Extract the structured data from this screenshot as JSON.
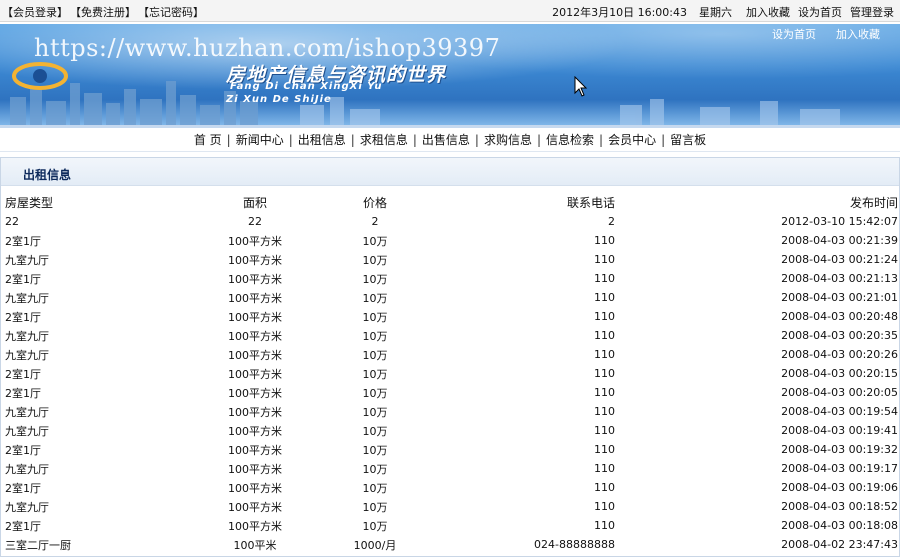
{
  "topbar": {
    "links": [
      "【会员登录】",
      "【免费注册】",
      "【忘记密码】"
    ],
    "datetime": "2012年3月10日 16:00:43",
    "weekday": "星期六",
    "right_links": [
      "加入收藏",
      "设为首页",
      "管理登录"
    ]
  },
  "banner": {
    "watermark": "https://www.huzhan.com/ishop39397",
    "slogan": "房地产信息与咨讯的世界",
    "pinyin1": "Fang Di Chan XingXi Yu",
    "pinyin2": "Zi Xun De ShiJie",
    "toplinks": [
      "设为首页",
      "加入收藏"
    ]
  },
  "nav": [
    "首 页",
    "新闻中心",
    "出租信息",
    "求租信息",
    "出售信息",
    "求购信息",
    "信息检索",
    "会员中心",
    "留言板"
  ],
  "panel": {
    "title": "出租信息",
    "headers": [
      "房屋类型",
      "面积",
      "价格",
      "联系电话",
      "发布时间"
    ],
    "rows": [
      [
        "22",
        "22",
        "2",
        "2",
        "2012-03-10 15:42:07"
      ],
      [
        "2室1厅",
        "100平方米",
        "10万",
        "110",
        "2008-04-03 00:21:39"
      ],
      [
        "九室九厅",
        "100平方米",
        "10万",
        "110",
        "2008-04-03 00:21:24"
      ],
      [
        "2室1厅",
        "100平方米",
        "10万",
        "110",
        "2008-04-03 00:21:13"
      ],
      [
        "九室九厅",
        "100平方米",
        "10万",
        "110",
        "2008-04-03 00:21:01"
      ],
      [
        "2室1厅",
        "100平方米",
        "10万",
        "110",
        "2008-04-03 00:20:48"
      ],
      [
        "九室九厅",
        "100平方米",
        "10万",
        "110",
        "2008-04-03 00:20:35"
      ],
      [
        "九室九厅",
        "100平方米",
        "10万",
        "110",
        "2008-04-03 00:20:26"
      ],
      [
        "2室1厅",
        "100平方米",
        "10万",
        "110",
        "2008-04-03 00:20:15"
      ],
      [
        "2室1厅",
        "100平方米",
        "10万",
        "110",
        "2008-04-03 00:20:05"
      ],
      [
        "九室九厅",
        "100平方米",
        "10万",
        "110",
        "2008-04-03 00:19:54"
      ],
      [
        "九室九厅",
        "100平方米",
        "10万",
        "110",
        "2008-04-03 00:19:41"
      ],
      [
        "2室1厅",
        "100平方米",
        "10万",
        "110",
        "2008-04-03 00:19:32"
      ],
      [
        "九室九厅",
        "100平方米",
        "10万",
        "110",
        "2008-04-03 00:19:17"
      ],
      [
        "2室1厅",
        "100平方米",
        "10万",
        "110",
        "2008-04-03 00:19:06"
      ],
      [
        "九室九厅",
        "100平方米",
        "10万",
        "110",
        "2008-04-03 00:18:52"
      ],
      [
        "2室1厅",
        "100平方米",
        "10万",
        "110",
        "2008-04-03 00:18:08"
      ],
      [
        "三室二厅一厨",
        "100平米",
        "1000/月",
        "024-88888888",
        "2008-04-02 23:47:43"
      ]
    ]
  }
}
